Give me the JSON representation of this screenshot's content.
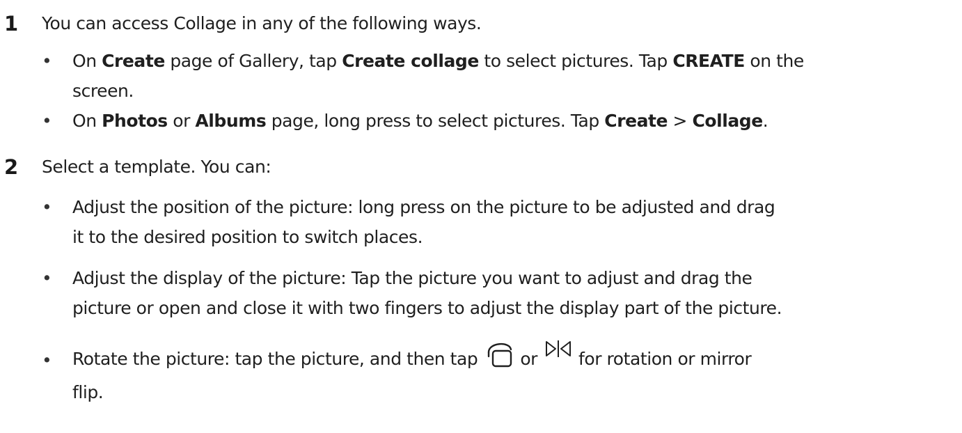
{
  "steps": [
    {
      "number": "1",
      "text": "You can access Collage in any of the following ways.",
      "bullets": [
        {
          "dot": "•",
          "line1": [
            {
              "t": "On ",
              "b": false
            },
            {
              "t": "Create",
              "b": true
            },
            {
              "t": " page of Gallery, tap ",
              "b": false
            },
            {
              "t": "Create collage",
              "b": true
            },
            {
              "t": " to select pictures. Tap ",
              "b": false
            },
            {
              "t": "CREATE",
              "b": true
            },
            {
              "t": " on the",
              "b": false
            }
          ],
          "line2": "screen."
        },
        {
          "dot": "•",
          "line1": [
            {
              "t": "On ",
              "b": false
            },
            {
              "t": "Photos",
              "b": true
            },
            {
              "t": " or ",
              "b": false
            },
            {
              "t": "Albums",
              "b": true
            },
            {
              "t": " page, long press to select pictures. Tap ",
              "b": false
            },
            {
              "t": "Create",
              "b": true
            },
            {
              "t": " > ",
              "b": false
            },
            {
              "t": "Collage",
              "b": true
            },
            {
              "t": ".",
              "b": false
            }
          ]
        }
      ]
    },
    {
      "number": "2",
      "text": "Select a template. You can:",
      "bullets": [
        {
          "dot": "•",
          "line1": "Adjust the position of the picture: long press on the picture to be adjusted and drag",
          "line2": "it to the desired position to switch places."
        },
        {
          "dot": "•",
          "line1": "Adjust the display of the picture: Tap the picture you want to adjust and drag the",
          "line2": "picture or open and close it with two fingers to adjust the display part of the picture."
        },
        {
          "dot": "•",
          "before_icon1": "Rotate the picture: tap the picture, and then tap ",
          "icon1": "rotate-icon",
          "between_icons": " or ",
          "icon2": "mirror-flip-icon",
          "after_icon2": " for rotation or mirror",
          "line2": "flip."
        }
      ]
    }
  ]
}
